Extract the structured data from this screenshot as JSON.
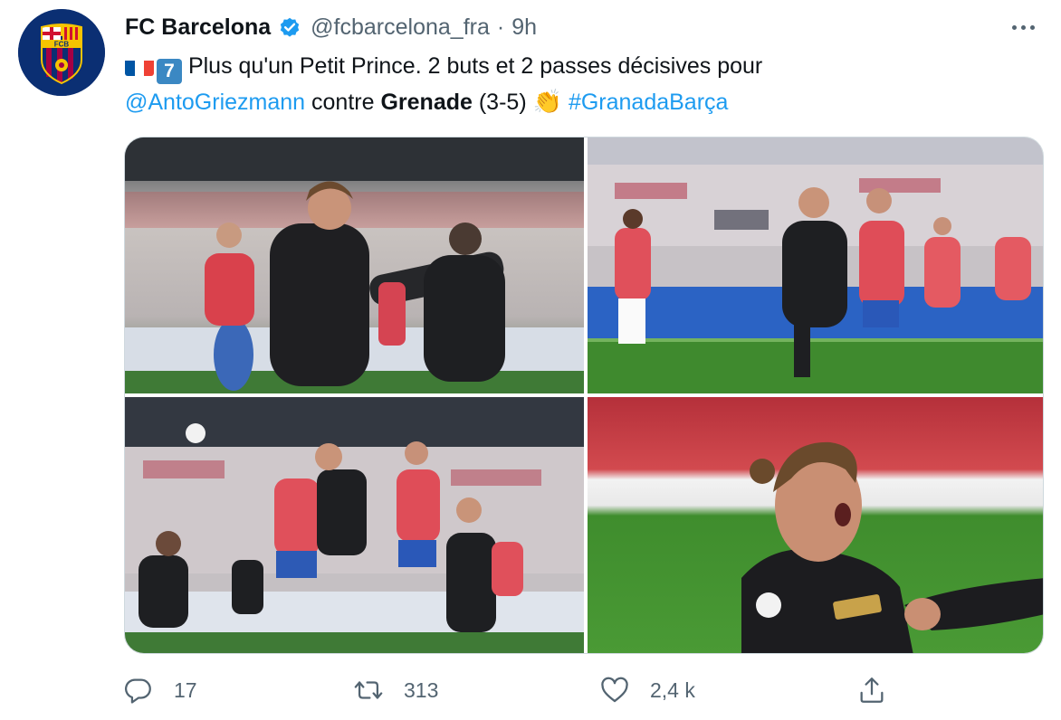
{
  "tweet": {
    "display_name": "FC Barcelona",
    "handle": "@fcbarcelona_fra",
    "separator": "·",
    "time": "9h",
    "avatar_icon": "fc-barcelona-crest",
    "avatar_text": "FCB",
    "verified_icon": "verified-badge-icon",
    "text": {
      "keycap": "7",
      "part1": "Plus qu'un Petit Prince. 2 buts et 2 passes décisives pour",
      "mention": "@AntoGriezmann",
      "part2": "contre",
      "bold": "Grenade",
      "part3": "(3-5)",
      "emoji": "👏",
      "hashtag": "#GranadaBarça"
    },
    "media": [
      {
        "name": "photo-celebration-1"
      },
      {
        "name": "photo-celebration-2"
      },
      {
        "name": "photo-header-duel"
      },
      {
        "name": "photo-closeup-shout"
      }
    ],
    "actions": {
      "replies": "17",
      "retweets": "313",
      "likes": "2,4 k"
    }
  },
  "colors": {
    "link": "#1d9bf0",
    "secondary_text": "#536471",
    "barca_blue": "#0b2f73",
    "barca_red": "#a50044"
  }
}
